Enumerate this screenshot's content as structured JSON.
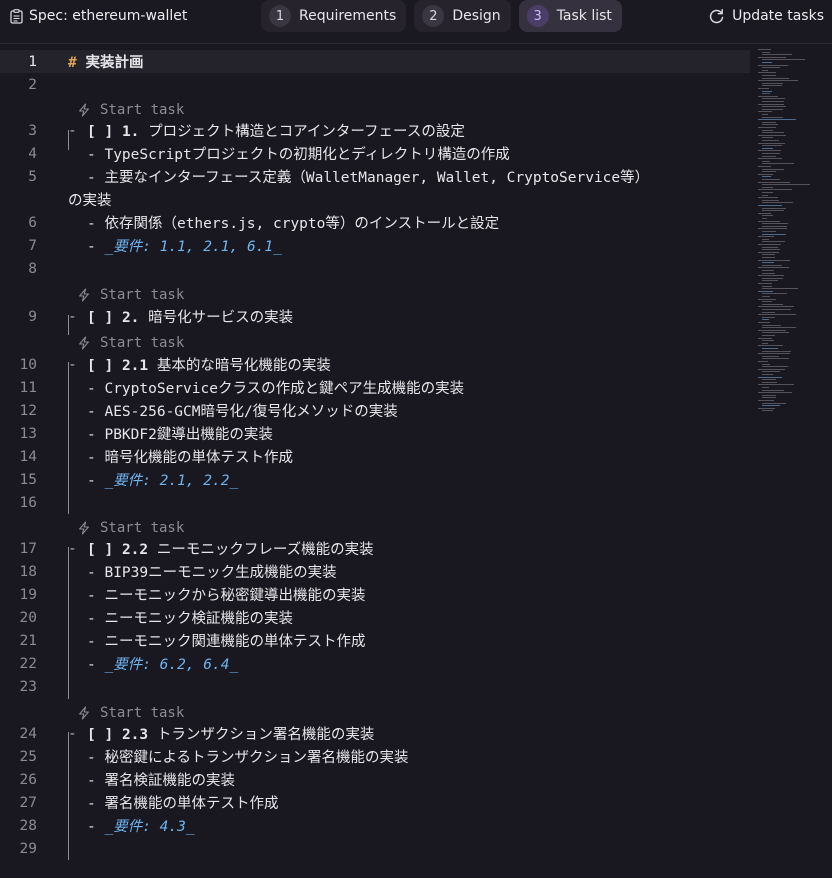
{
  "header": {
    "spec_title": "Spec: ethereum-wallet",
    "tabs": [
      {
        "num": "1",
        "label": "Requirements"
      },
      {
        "num": "2",
        "label": "Design"
      },
      {
        "num": "3",
        "label": "Task list"
      }
    ],
    "update_label": "Update tasks"
  },
  "editor": {
    "codelens_label": "Start task",
    "lines": {
      "l1": {
        "num": "1",
        "hash": "#",
        "text": " 実装計画"
      },
      "l2": {
        "num": "2"
      },
      "l3": {
        "num": "3",
        "box": "[ ]",
        "id": "1.",
        "text": " プロジェクト構造とコアインターフェースの設定"
      },
      "l4": {
        "num": "4",
        "prefix": "- ",
        "text": "TypeScriptプロジェクトの初期化とディレクトリ構造の作成"
      },
      "l5": {
        "num": "5",
        "prefix": "- ",
        "text": "主要なインターフェース定義（WalletManager, Wallet, CryptoService等）"
      },
      "l5b": {
        "text": "の実装"
      },
      "l6": {
        "num": "6",
        "prefix": "- ",
        "text": "依存関係（ethers.js, crypto等）のインストールと設定"
      },
      "l7": {
        "num": "7",
        "prefix": "- ",
        "text": "_要件: 1.1, 2.1, 6.1_"
      },
      "l8": {
        "num": "8"
      },
      "l9": {
        "num": "9",
        "box": "[ ]",
        "id": "2.",
        "text": " 暗号化サービスの実装"
      },
      "l10": {
        "num": "10",
        "box": "[ ]",
        "id": "2.1",
        "text": " 基本的な暗号化機能の実装"
      },
      "l11": {
        "num": "11",
        "prefix": "- ",
        "text": "CryptoServiceクラスの作成と鍵ペア生成機能の実装"
      },
      "l12": {
        "num": "12",
        "prefix": "- ",
        "text": "AES-256-GCM暗号化/復号化メソッドの実装"
      },
      "l13": {
        "num": "13",
        "prefix": "- ",
        "text": "PBKDF2鍵導出機能の実装"
      },
      "l14": {
        "num": "14",
        "prefix": "- ",
        "text": "暗号化機能の単体テスト作成"
      },
      "l15": {
        "num": "15",
        "prefix": "- ",
        "text": "_要件: 2.1, 2.2_"
      },
      "l16": {
        "num": "16"
      },
      "l17": {
        "num": "17",
        "box": "[ ]",
        "id": "2.2",
        "text": " ニーモニックフレーズ機能の実装"
      },
      "l18": {
        "num": "18",
        "prefix": "- ",
        "text": "BIP39ニーモニック生成機能の実装"
      },
      "l19": {
        "num": "19",
        "prefix": "- ",
        "text": "ニーモニックから秘密鍵導出機能の実装"
      },
      "l20": {
        "num": "20",
        "prefix": "- ",
        "text": "ニーモニック検証機能の実装"
      },
      "l21": {
        "num": "21",
        "prefix": "- ",
        "text": "ニーモニック関連機能の単体テスト作成"
      },
      "l22": {
        "num": "22",
        "prefix": "- ",
        "text": "_要件: 6.2, 6.4_"
      },
      "l23": {
        "num": "23"
      },
      "l24": {
        "num": "24",
        "box": "[ ]",
        "id": "2.3",
        "text": " トランザクション署名機能の実装"
      },
      "l25": {
        "num": "25",
        "prefix": "- ",
        "text": "秘密鍵によるトランザクション署名機能の実装"
      },
      "l26": {
        "num": "26",
        "prefix": "- ",
        "text": "署名検証機能の実装"
      },
      "l27": {
        "num": "27",
        "prefix": "- ",
        "text": "署名機能の単体テスト作成"
      },
      "l28": {
        "num": "28",
        "prefix": "- ",
        "text": "_要件: 4.3_"
      },
      "l29": {
        "num": "29"
      }
    }
  },
  "colors": {
    "background": "#19171f",
    "heading_hash": "#e0a458",
    "requirement_link": "#6eb4f0",
    "active_tab_badge": "#c9b8ff"
  },
  "icons": {
    "spec": "clipboard-icon",
    "update": "refresh-icon",
    "codelens": "lightning-icon"
  }
}
